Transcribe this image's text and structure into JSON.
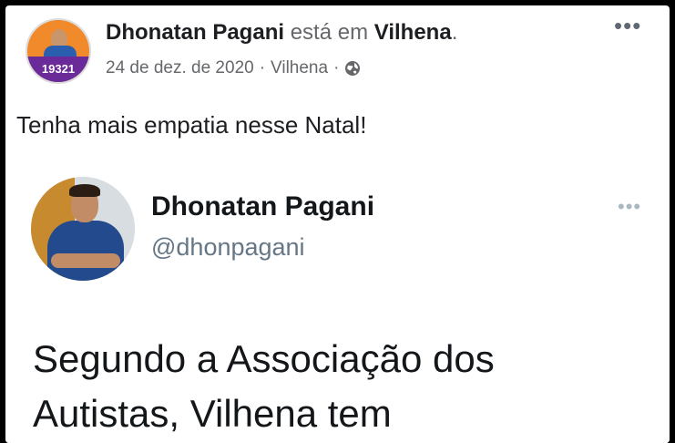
{
  "post": {
    "author": "Dhonatan Pagani",
    "connector": "está em",
    "location": "Vilhena",
    "period": ".",
    "date": "24 de dez. de 2020",
    "meta_location": "Vilhena",
    "separator": "·",
    "avatar_number": "19321",
    "more": "•••",
    "text": "Tenha mais empatia nesse Natal!"
  },
  "tweet": {
    "name": "Dhonatan Pagani",
    "handle": "@dhonpagani",
    "more": "•••",
    "text_line1": "Segundo a Associação dos",
    "text_line2": "Autistas, Vilhena tem"
  }
}
